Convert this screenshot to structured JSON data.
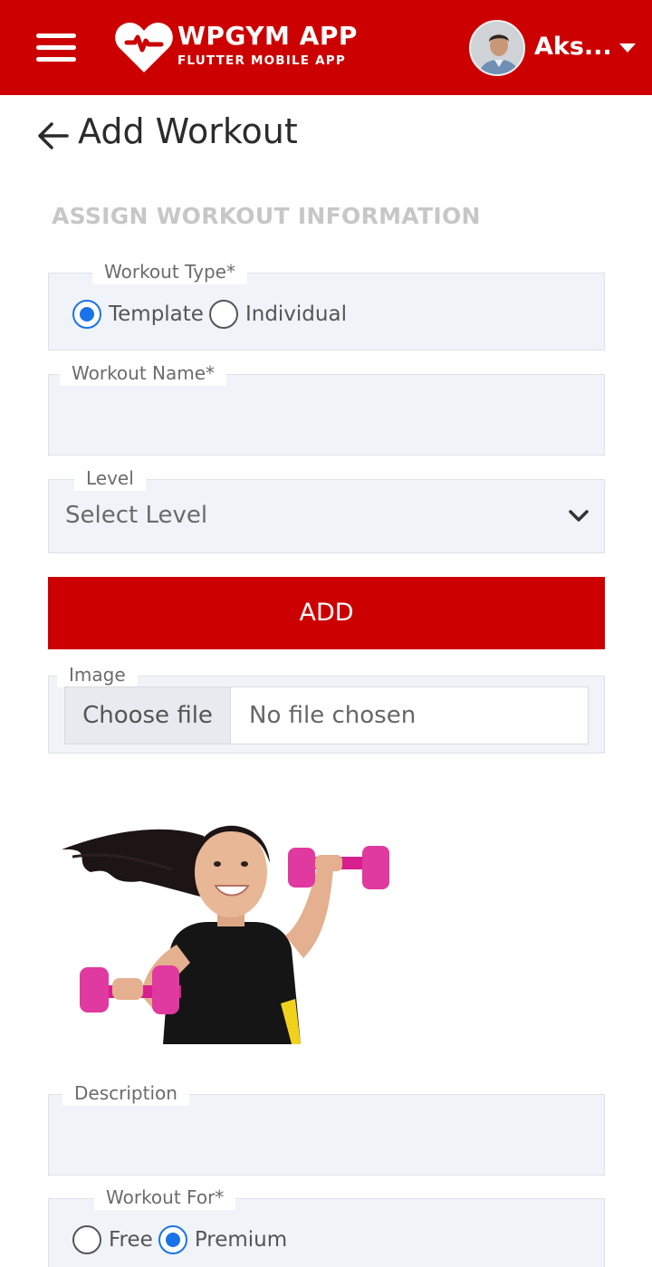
{
  "header": {
    "brand_title": "WPGYM APP",
    "brand_subtitle": "FLUTTER MOBILE APP",
    "user_name": "Aks...",
    "background_color": "#cc0000"
  },
  "page": {
    "title": "Add Workout",
    "section_title": "ASSIGN WORKOUT INFORMATION"
  },
  "form": {
    "workout_type": {
      "label": "Workout Type*",
      "options": [
        "Template",
        "Individual"
      ],
      "selected": "Template"
    },
    "workout_name": {
      "label": "Workout Name*",
      "value": ""
    },
    "level": {
      "label": "Level",
      "value": "Select Level"
    },
    "add_button": "ADD",
    "image": {
      "label": "Image",
      "choose_button": "Choose file",
      "status": "No file chosen"
    },
    "description": {
      "label": "Description",
      "value": ""
    },
    "workout_for": {
      "label": "Workout For*",
      "options": [
        "Free",
        "Premium"
      ],
      "selected": "Premium"
    }
  },
  "colors": {
    "accent": "#cc0000",
    "radio_selected": "#1a73e8",
    "field_bg": "#f0f3f8"
  },
  "icons": [
    "menu-icon",
    "brand-logo-icon",
    "caret-down-icon",
    "back-arrow-icon",
    "chevron-down-icon"
  ]
}
